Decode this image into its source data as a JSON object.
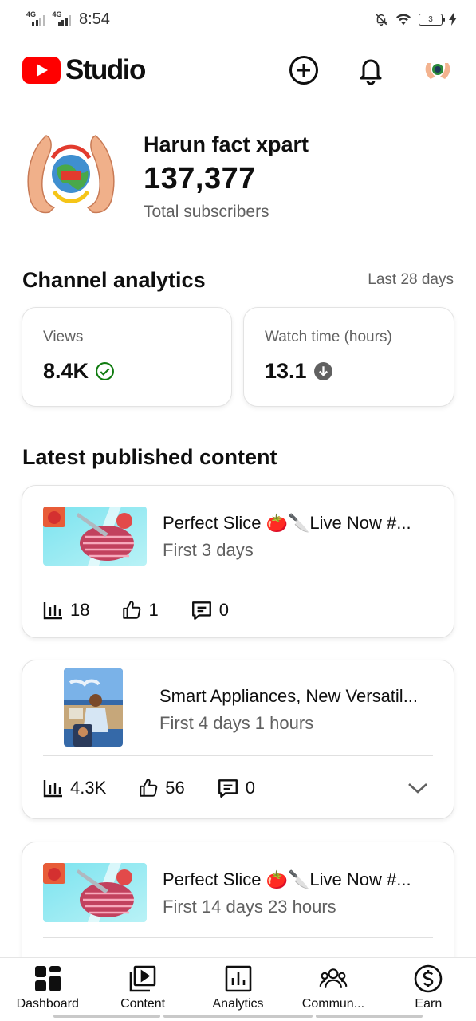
{
  "status_bar": {
    "network_1": "4G",
    "network_2": "4G",
    "time": "8:54",
    "battery_level": "3",
    "icons": [
      "mute-bell-icon",
      "wifi-icon",
      "battery-icon",
      "charging-icon"
    ]
  },
  "header": {
    "logo_text": "Studio",
    "brand_color": "#ff0000",
    "icons": [
      "create-icon",
      "notifications-icon",
      "account-avatar"
    ]
  },
  "channel": {
    "name": "Harun fact xpart",
    "subscribers": "137,377",
    "subscribers_label": "Total subscribers"
  },
  "analytics": {
    "title": "Channel analytics",
    "period": "Last 28 days",
    "metrics": [
      {
        "label": "Views",
        "value": "8.4K",
        "indicator": "check-circle-icon",
        "indicator_color": "#0f7b0f"
      },
      {
        "label": "Watch time (hours)",
        "value": "13.1",
        "indicator": "arrow-down-circle-icon",
        "indicator_color": "#606060"
      }
    ]
  },
  "latest": {
    "title": "Latest published content",
    "items": [
      {
        "title": "Perfect Slice 🍅🔪Live  Now #...",
        "period": "First 3 days",
        "views": "18",
        "likes": "1",
        "comments": "0"
      },
      {
        "title": "Smart Appliances, New Versatil...",
        "period": "First 4 days 1 hours",
        "views": "4.3K",
        "likes": "56",
        "comments": "0"
      },
      {
        "title": "Perfect Slice 🍅🔪Live  Now #...",
        "period": "First 14 days 23 hours"
      }
    ]
  },
  "bottom_nav": [
    {
      "label": "Dashboard",
      "icon": "dashboard-icon"
    },
    {
      "label": "Content",
      "icon": "content-icon"
    },
    {
      "label": "Analytics",
      "icon": "analytics-icon"
    },
    {
      "label": "Commun...",
      "icon": "community-icon"
    },
    {
      "label": "Earn",
      "icon": "earn-icon"
    }
  ]
}
